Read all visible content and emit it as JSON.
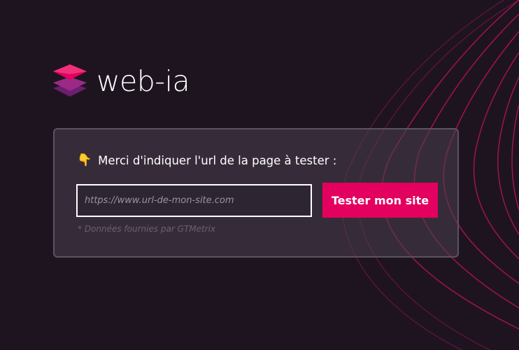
{
  "brand": {
    "name": "web-ia",
    "logo_icon": "layers-icon",
    "accent_color": "#e3005f"
  },
  "form": {
    "prompt_emoji": "👇",
    "prompt_icon": "pointing-down-icon",
    "prompt_text": "Merci d'indiquer l'url de la page à tester :",
    "url_placeholder": "https://www.url-de-mon-site.com",
    "url_value": "",
    "submit_label": "Tester mon site",
    "credits_text": "* Données fournies par GTMetrix"
  },
  "colors": {
    "background": "#1e1420",
    "wave_line": "#c0125f",
    "card_border": "#5d5360"
  }
}
